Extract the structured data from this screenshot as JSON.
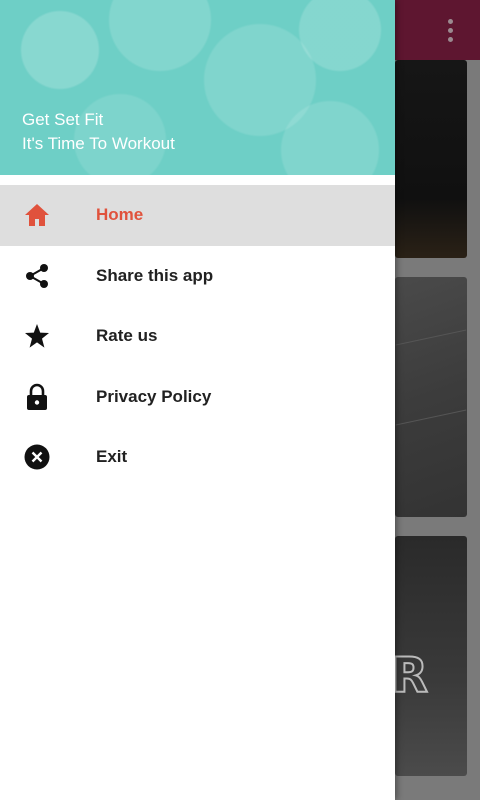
{
  "drawer": {
    "title": "Get Set Fit",
    "subtitle": "It's Time To Workout",
    "items": [
      {
        "label": "Home",
        "icon": "home-icon",
        "active": true
      },
      {
        "label": "Share this app",
        "icon": "share-icon",
        "active": false
      },
      {
        "label": "Rate us",
        "icon": "star-icon",
        "active": false
      },
      {
        "label": "Privacy Policy",
        "icon": "lock-icon",
        "active": false
      },
      {
        "label": "Exit",
        "icon": "close-circle-icon",
        "active": false
      }
    ]
  },
  "toolbar": {
    "overflow_icon": "more-vert-icon"
  },
  "colors": {
    "header_bg": "#6ecfc6",
    "toolbar_bg": "#5e1630",
    "active_text": "#e0523c",
    "active_row_bg": "#dedede"
  }
}
